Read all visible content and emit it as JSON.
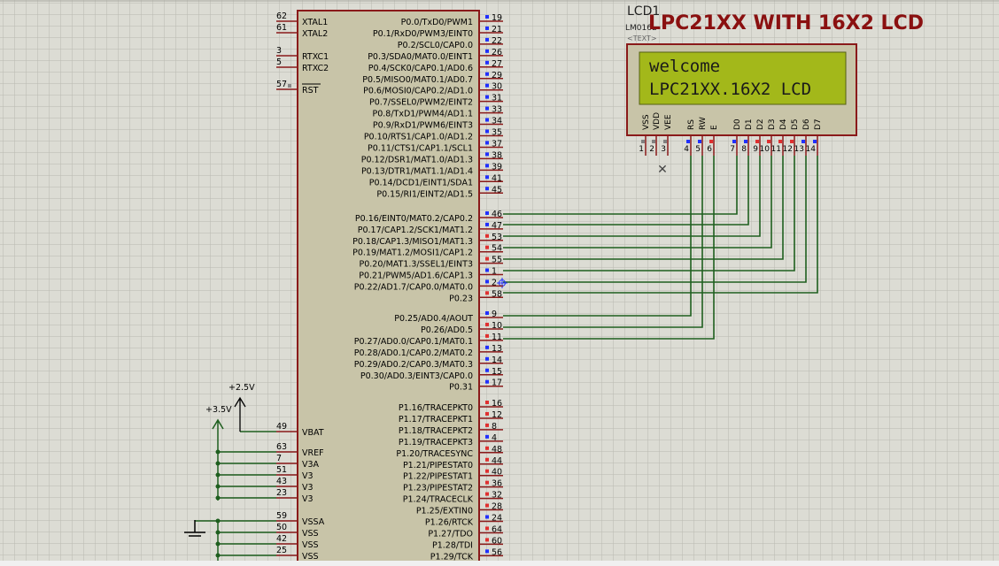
{
  "title": "LPC21XX WITH 16X2 LCD",
  "lcd": {
    "ref": "LCD1",
    "part": "LM016L",
    "text_tag": "<TEXT>",
    "line1": "welcome",
    "line2": "LPC21XX.16X2 LCD",
    "pin_labels": [
      "VSS",
      "VDD",
      "VEE",
      "RS",
      "RW",
      "E",
      "D0",
      "D1",
      "D2",
      "D3",
      "D4",
      "D5",
      "D6",
      "D7"
    ],
    "pin_numbers": [
      "1",
      "2",
      "3",
      "4",
      "5",
      "6",
      "7",
      "8",
      "9",
      "10",
      "11",
      "12",
      "13",
      "14"
    ]
  },
  "power": {
    "v1": "+2.5V",
    "v2": "+3.5V"
  },
  "left_pins": [
    {
      "name": "XTAL1",
      "num": "62"
    },
    {
      "name": "XTAL2",
      "num": "61"
    },
    {
      "name": "RTXC1",
      "num": "3"
    },
    {
      "name": "RTXC2",
      "num": "5"
    },
    {
      "name": "RST",
      "num": "57"
    },
    {
      "name": "VBAT",
      "num": "49"
    },
    {
      "name": "VREF",
      "num": "63"
    },
    {
      "name": "V3A",
      "num": "7"
    },
    {
      "name": "V3",
      "num": "51"
    },
    {
      "name": "V3",
      "num": "43"
    },
    {
      "name": "V3",
      "num": "23"
    },
    {
      "name": "VSSA",
      "num": "59"
    },
    {
      "name": "VSS",
      "num": "50"
    },
    {
      "name": "VSS",
      "num": "42"
    },
    {
      "name": "VSS",
      "num": "25"
    }
  ],
  "right_pins": [
    {
      "name": "P0.0/TxD0/PWM1",
      "num": "19"
    },
    {
      "name": "P0.1/RxD0/PWM3/EINT0",
      "num": "21"
    },
    {
      "name": "P0.2/SCL0/CAP0.0",
      "num": "22"
    },
    {
      "name": "P0.3/SDA0/MAT0.0/EINT1",
      "num": "26"
    },
    {
      "name": "P0.4/SCK0/CAP0.1/AD0.6",
      "num": "27"
    },
    {
      "name": "P0.5/MISO0/MAT0.1/AD0.7",
      "num": "29"
    },
    {
      "name": "P0.6/MOSI0/CAP0.2/AD1.0",
      "num": "30"
    },
    {
      "name": "P0.7/SSEL0/PWM2/EINT2",
      "num": "31"
    },
    {
      "name": "P0.8/TxD1/PWM4/AD1.1",
      "num": "33"
    },
    {
      "name": "P0.9/RxD1/PWM6/EINT3",
      "num": "34"
    },
    {
      "name": "P0.10/RTS1/CAP1.0/AD1.2",
      "num": "35"
    },
    {
      "name": "P0.11/CTS1/CAP1.1/SCL1",
      "num": "37"
    },
    {
      "name": "P0.12/DSR1/MAT1.0/AD1.3",
      "num": "38"
    },
    {
      "name": "P0.13/DTR1/MAT1.1/AD1.4",
      "num": "39"
    },
    {
      "name": "P0.14/DCD1/EINT1/SDA1",
      "num": "41"
    },
    {
      "name": "P0.15/RI1/EINT2/AD1.5",
      "num": "45"
    },
    {
      "name": "P0.16/EINT0/MAT0.2/CAP0.2",
      "num": "46"
    },
    {
      "name": "P0.17/CAP1.2/SCK1/MAT1.2",
      "num": "47"
    },
    {
      "name": "P0.18/CAP1.3/MISO1/MAT1.3",
      "num": "53"
    },
    {
      "name": "P0.19/MAT1.2/MOSI1/CAP1.2",
      "num": "54"
    },
    {
      "name": "P0.20/MAT1.3/SSEL1/EINT3",
      "num": "55"
    },
    {
      "name": "P0.21/PWM5/AD1.6/CAP1.3",
      "num": "1"
    },
    {
      "name": "P0.22/AD1.7/CAP0.0/MAT0.0",
      "num": "2"
    },
    {
      "name": "P0.23",
      "num": "58"
    },
    {
      "name": "P0.25/AD0.4/AOUT",
      "num": "9"
    },
    {
      "name": "P0.26/AD0.5",
      "num": "10"
    },
    {
      "name": "P0.27/AD0.0/CAP0.1/MAT0.1",
      "num": "11"
    },
    {
      "name": "P0.28/AD0.1/CAP0.2/MAT0.2",
      "num": "13"
    },
    {
      "name": "P0.29/AD0.2/CAP0.3/MAT0.3",
      "num": "14"
    },
    {
      "name": "P0.30/AD0.3/EINT3/CAP0.0",
      "num": "15"
    },
    {
      "name": "P0.31",
      "num": "17"
    },
    {
      "name": "P1.16/TRACEPKT0",
      "num": "16"
    },
    {
      "name": "P1.17/TRACEPKT1",
      "num": "12"
    },
    {
      "name": "P1.18/TRACEPKT2",
      "num": "8"
    },
    {
      "name": "P1.19/TRACEPKT3",
      "num": "4"
    },
    {
      "name": "P1.20/TRACESYNC",
      "num": "48"
    },
    {
      "name": "P1.21/PIPESTAT0",
      "num": "44"
    },
    {
      "name": "P1.22/PIPESTAT1",
      "num": "40"
    },
    {
      "name": "P1.23/PIPESTAT2",
      "num": "36"
    },
    {
      "name": "P1.24/TRACECLK",
      "num": "32"
    },
    {
      "name": "P1.25/EXTIN0",
      "num": "28"
    },
    {
      "name": "P1.26/RTCK",
      "num": "24"
    },
    {
      "name": "P1.27/TDO",
      "num": "64"
    },
    {
      "name": "P1.28/TDI",
      "num": "60"
    },
    {
      "name": "P1.29/TCK",
      "num": "56"
    }
  ],
  "colors": {
    "wire": "#1f5f1f",
    "body": "#c8c4a8",
    "border": "#8a1a1a",
    "title": "#8a1010",
    "lcd_screen": "#a3b81a"
  }
}
